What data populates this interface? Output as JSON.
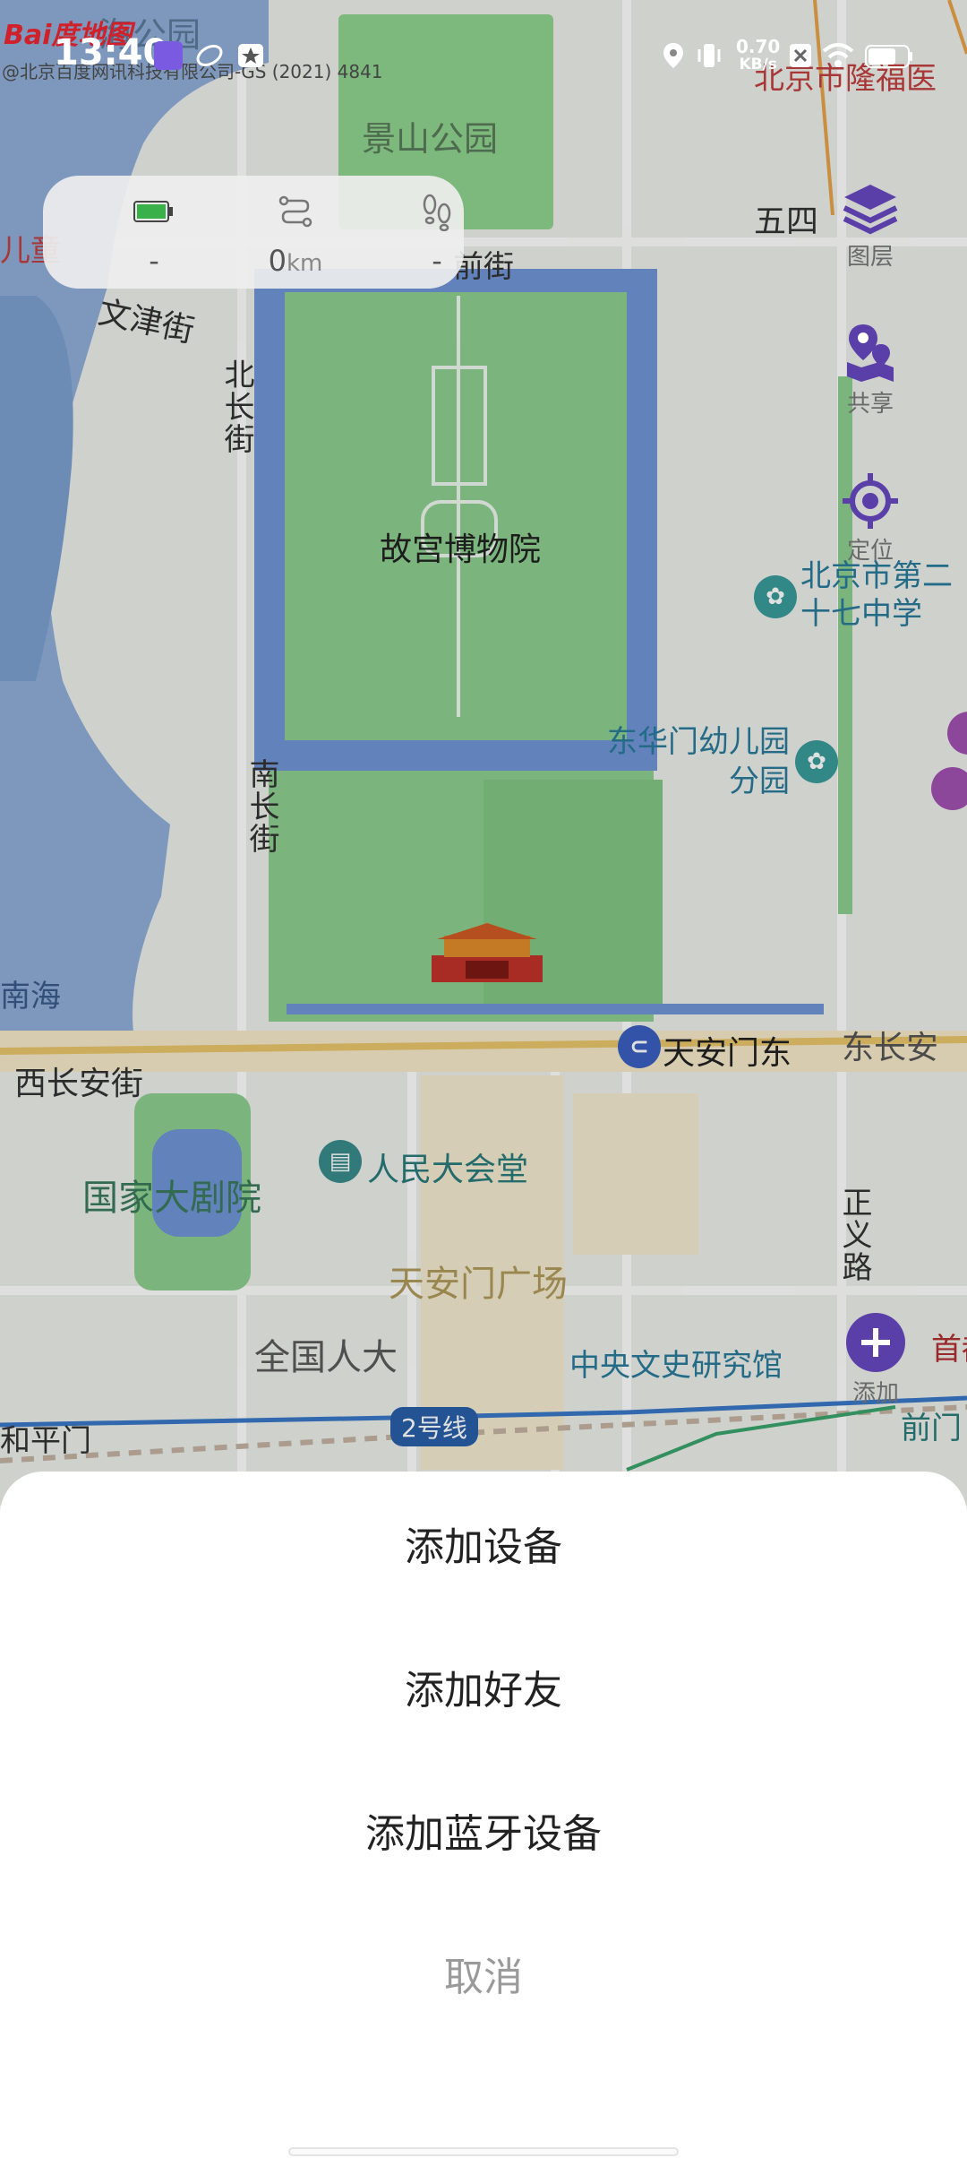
{
  "status_bar": {
    "time": "13:40",
    "net_speed_value": "0.70",
    "net_speed_unit": "KB/s"
  },
  "map_attribution": {
    "logo": "Bai度地图",
    "copyright": "@北京百度网讯科技有限公司-GS (2021) 4841"
  },
  "stats": {
    "battery_value": "-",
    "distance_value": "0",
    "distance_unit": "km",
    "steps_value": "-"
  },
  "tools": {
    "layers": "图层",
    "share": "共享",
    "locate": "定位",
    "add": "添加"
  },
  "map_labels": {
    "jingshan": "景山公园",
    "beihai": "海公园",
    "wusi": "五四",
    "qianjie": "前街",
    "ertong": "儿童",
    "wenjin": "文津街",
    "beichang": "北长街",
    "gugong": "故宫博物院",
    "nanchang": "南长街",
    "nanhai": "南海",
    "xichang": "西长安街",
    "tiananmen_east": "天安门东",
    "dongchang": "东长安",
    "renmin": "人民大会堂",
    "theatre": "国家大剧院",
    "square": "天安门广场",
    "npc": "全国人大",
    "zhengyi": "正义路",
    "wenshi": "中央文史研究馆",
    "hepingmen": "和平门",
    "line2": "2号线",
    "qianmen": "前门",
    "shoudu": "首都",
    "school": "北京市第二十七中学",
    "kindergarten": "东华门幼儿园分园",
    "longfu": "北京市隆福医"
  },
  "sheet": {
    "add_device": "添加设备",
    "add_friend": "添加好友",
    "add_bluetooth": "添加蓝牙设备",
    "cancel": "取消"
  },
  "colors": {
    "accent": "#5b3fa8",
    "sheet_bg": "#ffffff",
    "cancel_text": "#9a9a9a"
  }
}
